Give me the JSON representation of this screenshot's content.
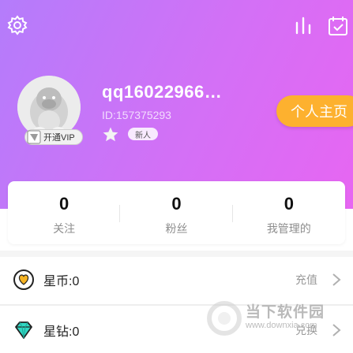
{
  "profile": {
    "username": "qq16022966…",
    "user_id": "ID:157375293",
    "vip_label": "开通VIP",
    "newbie_label": "新人",
    "homepage_button": "个人主页"
  },
  "stats": [
    {
      "value": "0",
      "label": "关注"
    },
    {
      "value": "0",
      "label": "粉丝"
    },
    {
      "value": "0",
      "label": "我管理的"
    }
  ],
  "wallet": {
    "coins": {
      "label": "星币:0",
      "action": "充值",
      "icon": "gold-heart-coin-icon"
    },
    "diamonds": {
      "label": "星钻:0",
      "action": "兑换",
      "icon": "teal-diamond-icon"
    }
  },
  "watermark": {
    "text": "当下软件园",
    "url": "www.downxia.com"
  },
  "colors": {
    "header_gradient_start": "#b47cfb",
    "header_gradient_end": "#e766f2",
    "homepage_button": "#fdb12f"
  }
}
